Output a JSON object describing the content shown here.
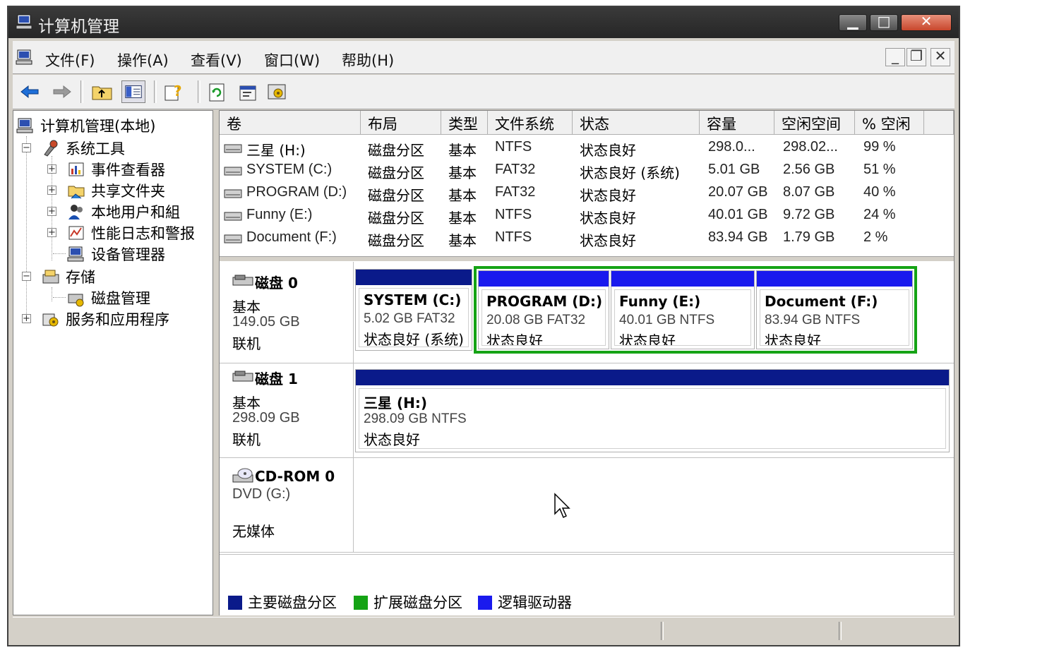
{
  "window": {
    "title": "计算机管理"
  },
  "menu": [
    "文件(F)",
    "操作(A)",
    "查看(V)",
    "窗口(W)",
    "帮助(H)"
  ],
  "tree": {
    "root": "计算机管理(本地)",
    "system_tools": "系统工具",
    "event_viewer": "事件查看器",
    "shared_folders": "共享文件夹",
    "local_users": "本地用户和組",
    "perf_logs": "性能日志和警报",
    "device_manager": "设备管理器",
    "storage": "存储",
    "disk_mgmt": "磁盘管理",
    "services": "服务和应用程序"
  },
  "columns": [
    "卷",
    "布局",
    "类型",
    "文件系统",
    "状态",
    "容量",
    "空闲空间",
    "% 空闲"
  ],
  "volumes": [
    [
      "三星 (H:)",
      "磁盘分区",
      "基本",
      "NTFS",
      "状态良好",
      "298.0...",
      "298.02...",
      "99 %"
    ],
    [
      "SYSTEM (C:)",
      "磁盘分区",
      "基本",
      "FAT32",
      "状态良好 (系统)",
      "5.01 GB",
      "2.56 GB",
      "51 %"
    ],
    [
      "PROGRAM (D:)",
      "磁盘分区",
      "基本",
      "FAT32",
      "状态良好",
      "20.07 GB",
      "8.07 GB",
      "40 %"
    ],
    [
      "Funny (E:)",
      "磁盘分区",
      "基本",
      "NTFS",
      "状态良好",
      "40.01 GB",
      "9.72 GB",
      "24 %"
    ],
    [
      "Document (F:)",
      "磁盘分区",
      "基本",
      "NTFS",
      "状态良好",
      "83.94 GB",
      "1.79 GB",
      "2 %"
    ]
  ],
  "disk0": {
    "name": "磁盘 0",
    "type": "基本",
    "size": "149.05 GB",
    "status": "联机",
    "partitions": [
      {
        "name": "SYSTEM  (C:)",
        "info": "5.02 GB FAT32",
        "status": "状态良好 (系统)"
      },
      {
        "name": "PROGRAM  (D:)",
        "info": "20.08 GB FAT32",
        "status": "状态良好"
      },
      {
        "name": "Funny  (E:)",
        "info": "40.01 GB NTFS",
        "status": "状态良好"
      },
      {
        "name": "Document  (F:)",
        "info": "83.94 GB NTFS",
        "status": "状态良好"
      }
    ]
  },
  "disk1": {
    "name": "磁盘 1",
    "type": "基本",
    "size": "298.09 GB",
    "status": "联机",
    "partitions": [
      {
        "name": "三星  (H:)",
        "info": "298.09 GB NTFS",
        "status": "状态良好"
      }
    ]
  },
  "cdrom": {
    "name": "CD-ROM 0",
    "drive": "DVD (G:)",
    "media": "无媒体"
  },
  "legend": [
    {
      "label": "主要磁盘分区",
      "color": "#0a1a8a"
    },
    {
      "label": "扩展磁盘分区",
      "color": "#15a315"
    },
    {
      "label": "逻辑驱动器",
      "color": "#1a1aee"
    }
  ],
  "colors": {
    "primary": "#0a1a8a",
    "extended": "#15a315",
    "logical": "#1a1aee"
  }
}
